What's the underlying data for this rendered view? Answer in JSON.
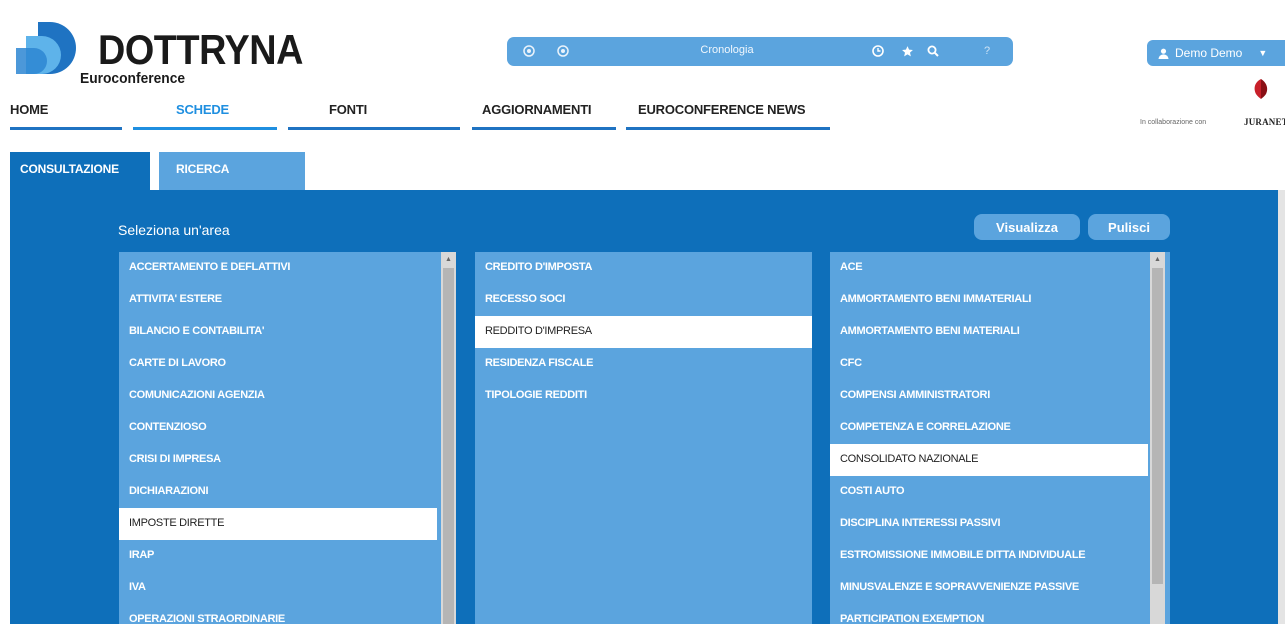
{
  "header": {
    "logo_title": "DOTTRYNA",
    "logo_subtitle": "Euroconference"
  },
  "nav": {
    "items": [
      {
        "label": "HOME",
        "active": false
      },
      {
        "label": "SCHEDE",
        "active": true
      },
      {
        "label": "FONTI",
        "active": false
      },
      {
        "label": "AGGIORNAMENTI",
        "active": false
      },
      {
        "label": "EUROCONFERENCE NEWS",
        "active": false
      }
    ]
  },
  "toolbar": {
    "label": "Cronologia",
    "icons": [
      "back-icon",
      "forward-icon",
      "clock-icon",
      "star-icon",
      "search-icon",
      "help-icon"
    ]
  },
  "user": {
    "name": "Demo Demo",
    "partner_text": "In collaborazione con",
    "partner_name": "JURANET"
  },
  "tabs": [
    {
      "label": "CONSULTAZIONE",
      "active": true
    },
    {
      "label": "RICERCA",
      "active": false
    }
  ],
  "panel": {
    "title": "Seleziona un'area",
    "visualizza_label": "Visualizza",
    "pulisci_label": "Pulisci"
  },
  "lists": {
    "areas": [
      {
        "label": "ACCERTAMENTO E DEFLATTIVI",
        "selected": false
      },
      {
        "label": "ATTIVITA' ESTERE",
        "selected": false
      },
      {
        "label": "BILANCIO E CONTABILITA'",
        "selected": false
      },
      {
        "label": "CARTE DI LAVORO",
        "selected": false
      },
      {
        "label": "COMUNICAZIONI AGENZIA",
        "selected": false
      },
      {
        "label": "CONTENZIOSO",
        "selected": false
      },
      {
        "label": "CRISI DI IMPRESA",
        "selected": false
      },
      {
        "label": "DICHIARAZIONI",
        "selected": false
      },
      {
        "label": "IMPOSTE DIRETTE",
        "selected": true
      },
      {
        "label": "IRAP",
        "selected": false
      },
      {
        "label": "IVA",
        "selected": false
      },
      {
        "label": "OPERAZIONI STRAORDINARIE",
        "selected": false
      }
    ],
    "subareas": [
      {
        "label": "CREDITO D'IMPOSTA",
        "selected": false
      },
      {
        "label": "RECESSO SOCI",
        "selected": false
      },
      {
        "label": "REDDITO D'IMPRESA",
        "selected": true
      },
      {
        "label": "RESIDENZA FISCALE",
        "selected": false
      },
      {
        "label": "TIPOLOGIE REDDITI",
        "selected": false
      }
    ],
    "topics": [
      {
        "label": "ACE",
        "selected": false
      },
      {
        "label": "AMMORTAMENTO BENI IMMATERIALI",
        "selected": false
      },
      {
        "label": "AMMORTAMENTO BENI MATERIALI",
        "selected": false
      },
      {
        "label": "CFC",
        "selected": false
      },
      {
        "label": "COMPENSI AMMINISTRATORI",
        "selected": false
      },
      {
        "label": "COMPETENZA E CORRELAZIONE",
        "selected": false
      },
      {
        "label": "CONSOLIDATO NAZIONALE",
        "selected": true
      },
      {
        "label": "COSTI AUTO",
        "selected": false
      },
      {
        "label": "DISCIPLINA INTERESSI PASSIVI",
        "selected": false
      },
      {
        "label": "ESTROMISSIONE IMMOBILE DITTA INDIVIDUALE",
        "selected": false
      },
      {
        "label": "MINUSVALENZE E SOPRAVVENIENZE PASSIVE",
        "selected": false
      },
      {
        "label": "PARTICIPATION EXEMPTION",
        "selected": false
      }
    ]
  },
  "colors": {
    "primary": "#0e6fba",
    "accent": "#5ba4de",
    "nav_active": "#1f8fe0"
  }
}
